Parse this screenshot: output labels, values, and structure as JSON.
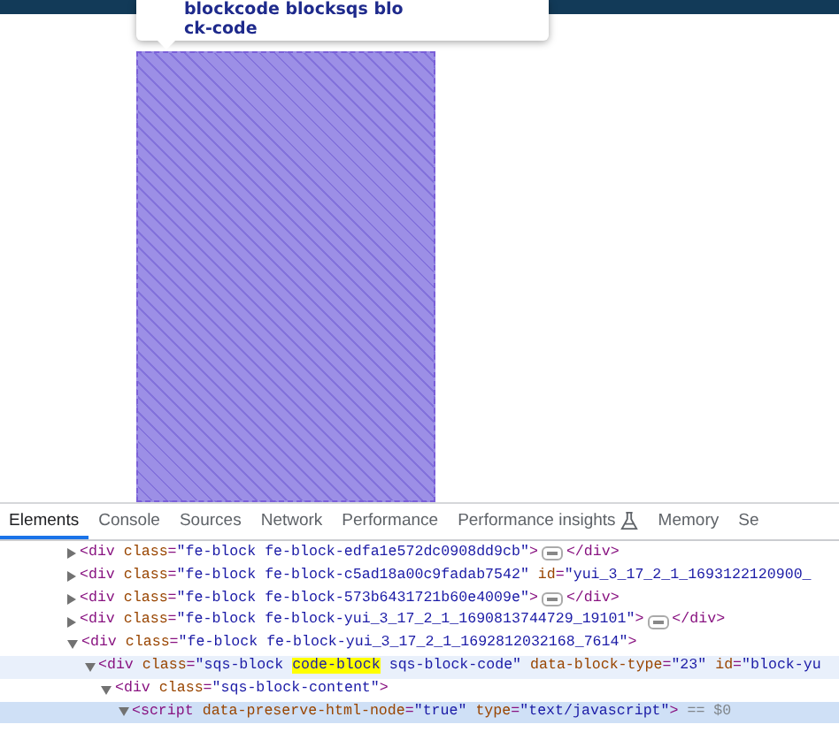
{
  "tooltip": {
    "lines": [
      "blockcode blocksqs blo",
      "ck-code"
    ]
  },
  "tabs": [
    {
      "label": "Elements",
      "selected": true,
      "kind": "text"
    },
    {
      "label": "Console",
      "selected": false,
      "kind": "text"
    },
    {
      "label": "Sources",
      "selected": false,
      "kind": "text"
    },
    {
      "label": "Network",
      "selected": false,
      "kind": "text"
    },
    {
      "label": "Performance",
      "selected": false,
      "kind": "text"
    },
    {
      "label": "Performance insights",
      "selected": false,
      "kind": "flask"
    },
    {
      "label": "Memory",
      "selected": false,
      "kind": "text"
    },
    {
      "label": "Se",
      "selected": false,
      "kind": "text"
    }
  ],
  "tree": [
    {
      "expanded": false,
      "hovered": false,
      "selected": false,
      "ellipsis": true,
      "open": [
        {
          "kind": "tag",
          "text": "<div"
        },
        {
          "kind": "attr",
          "text": " class"
        },
        {
          "kind": "punct",
          "text": "="
        },
        {
          "kind": "value",
          "text": "\"fe-block fe-block-edfa1e572dc0908dd9cb\""
        },
        {
          "kind": "tag",
          "text": ">"
        }
      ],
      "close": [
        {
          "kind": "tag",
          "text": "</div>"
        }
      ]
    },
    {
      "expanded": false,
      "hovered": false,
      "selected": false,
      "ellipsis": false,
      "open": [
        {
          "kind": "tag",
          "text": "<div"
        },
        {
          "kind": "attr",
          "text": " class"
        },
        {
          "kind": "punct",
          "text": "="
        },
        {
          "kind": "value",
          "text": "\"fe-block fe-block-c5ad18a00c9fadab7542\""
        },
        {
          "kind": "attr",
          "text": " id"
        },
        {
          "kind": "punct",
          "text": "="
        },
        {
          "kind": "value",
          "text": "\"yui_3_17_2_1_1693122120900_"
        }
      ]
    },
    {
      "expanded": false,
      "hovered": false,
      "selected": false,
      "ellipsis": true,
      "open": [
        {
          "kind": "tag",
          "text": "<div"
        },
        {
          "kind": "attr",
          "text": " class"
        },
        {
          "kind": "punct",
          "text": "="
        },
        {
          "kind": "value",
          "text": "\"fe-block fe-block-573b6431721b60e4009e\""
        },
        {
          "kind": "tag",
          "text": ">"
        }
      ],
      "close": [
        {
          "kind": "tag",
          "text": "</div>"
        }
      ]
    },
    {
      "expanded": false,
      "hovered": false,
      "selected": false,
      "ellipsis": true,
      "open": [
        {
          "kind": "tag",
          "text": "<div"
        },
        {
          "kind": "attr",
          "text": " class"
        },
        {
          "kind": "punct",
          "text": "="
        },
        {
          "kind": "value",
          "text": "\"fe-block fe-block-yui_3_17_2_1_1690813744729_19101\""
        },
        {
          "kind": "tag",
          "text": ">"
        }
      ],
      "close": [
        {
          "kind": "tag",
          "text": "</div>"
        }
      ]
    },
    {
      "expanded": true,
      "hovered": false,
      "selected": false,
      "ellipsis": false,
      "open": [
        {
          "kind": "tag",
          "text": "<div"
        },
        {
          "kind": "attr",
          "text": " class"
        },
        {
          "kind": "punct",
          "text": "="
        },
        {
          "kind": "value",
          "text": "\"fe-block fe-block-yui_3_17_2_1_1692812032168_7614\""
        },
        {
          "kind": "tag",
          "text": ">"
        }
      ],
      "children": [
        {
          "expanded": true,
          "hovered": true,
          "selected": false,
          "ellipsis": false,
          "open": [
            {
              "kind": "tag",
              "text": "<div"
            },
            {
              "kind": "attr",
              "text": " class"
            },
            {
              "kind": "punct",
              "text": "="
            },
            {
              "kind": "value",
              "text": "\"sqs-block "
            },
            {
              "kind": "match",
              "text": "code-block"
            },
            {
              "kind": "value",
              "text": " sqs-block-code\""
            },
            {
              "kind": "attr",
              "text": " data-block-type"
            },
            {
              "kind": "punct",
              "text": "="
            },
            {
              "kind": "value",
              "text": "\"23\""
            },
            {
              "kind": "attr",
              "text": " id"
            },
            {
              "kind": "punct",
              "text": "="
            },
            {
              "kind": "value",
              "text": "\"block-yu"
            }
          ],
          "children": [
            {
              "expanded": true,
              "hovered": false,
              "selected": false,
              "ellipsis": false,
              "open": [
                {
                  "kind": "tag",
                  "text": "<div"
                },
                {
                  "kind": "attr",
                  "text": " class"
                },
                {
                  "kind": "punct",
                  "text": "="
                },
                {
                  "kind": "value",
                  "text": "\"sqs-block-content\""
                },
                {
                  "kind": "tag",
                  "text": ">"
                }
              ],
              "children": [
                {
                  "expanded": true,
                  "hovered": false,
                  "selected": true,
                  "ellipsis": false,
                  "open": [
                    {
                      "kind": "tag",
                      "text": "<script"
                    },
                    {
                      "kind": "attr",
                      "text": " data-preserve-html-node"
                    },
                    {
                      "kind": "punct",
                      "text": "="
                    },
                    {
                      "kind": "value",
                      "text": "\"true\""
                    },
                    {
                      "kind": "attr",
                      "text": " type"
                    },
                    {
                      "kind": "punct",
                      "text": "="
                    },
                    {
                      "kind": "value",
                      "text": "\"text/javascript\""
                    },
                    {
                      "kind": "tag",
                      "text": ">"
                    },
                    {
                      "kind": "dim",
                      "text": " == $0"
                    }
                  ]
                }
              ]
            }
          ]
        }
      ]
    }
  ]
}
